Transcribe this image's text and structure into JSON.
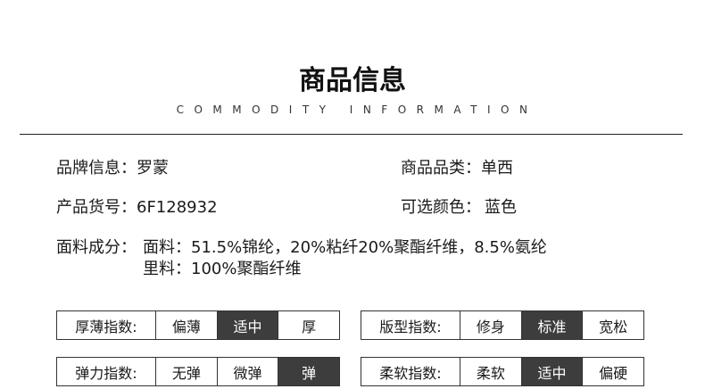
{
  "header": {
    "title": "商品信息",
    "subtitle": "COMMODITY INFORMATION"
  },
  "info": {
    "brand_label": "品牌信息：",
    "brand_value": "罗蒙",
    "category_label": "商品品类：",
    "category_value": "单西",
    "sku_label": "产品货号：",
    "sku_value": "6F128932",
    "color_label": "可选颜色：",
    "color_value": "蓝色",
    "fabric_label": "面料成分：",
    "fabric_line1": "面料：51.5%锦纶，20%粘纤20%聚酯纤维，8.5%氨纶",
    "fabric_line2": "里料：100%聚酯纤维"
  },
  "scales": {
    "thickness": {
      "label": "厚薄指数:",
      "options": [
        "偏薄",
        "适中",
        "厚"
      ],
      "selected": "适中"
    },
    "fit": {
      "label": "版型指数:",
      "options": [
        "修身",
        "标准",
        "宽松"
      ],
      "selected": "标准"
    },
    "stretch": {
      "label": "弹力指数:",
      "options": [
        "无弹",
        "微弹",
        "弹"
      ],
      "selected": "弹"
    },
    "softness": {
      "label": "柔软指数:",
      "options": [
        "柔软",
        "适中",
        "偏硬"
      ],
      "selected": "适中"
    }
  },
  "colors": {
    "selected_bg": "#3d3d3d",
    "border": "#333333",
    "text": "#1a1a1a"
  }
}
